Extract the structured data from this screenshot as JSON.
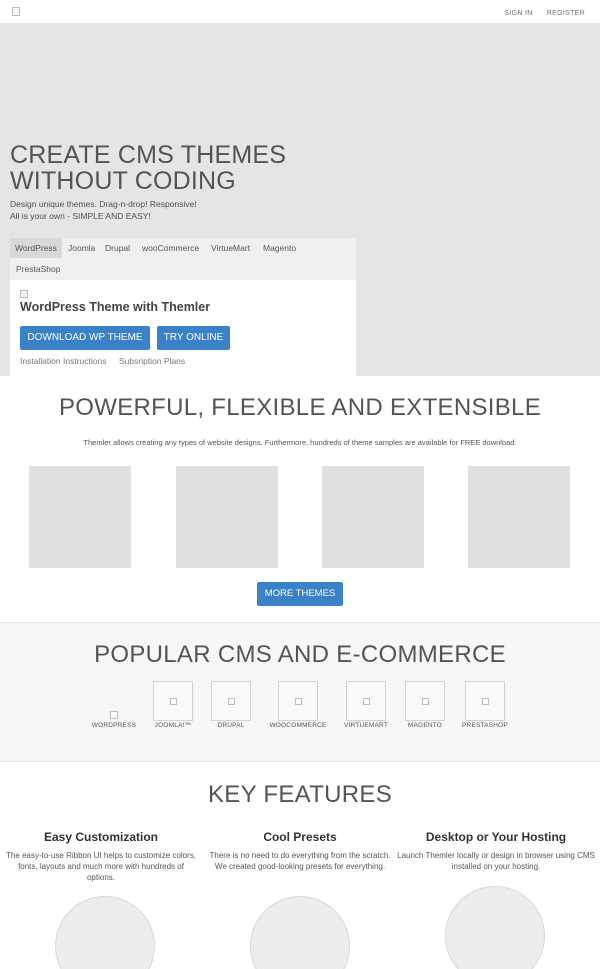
{
  "header": {
    "sign_in": "SIGN IN",
    "register": "REGISTER"
  },
  "hero": {
    "title_line1": "CREATE CMS THEMES",
    "title_line2": "WITHOUT CODING",
    "subtitle_line1": "Design unique themes. Drag-n-drop! Responsive!",
    "subtitle_line2": "All is your own - SIMPLE AND EASY!",
    "tabs": [
      "WordPress",
      "Joomla",
      "Drupal",
      "wooCommerce",
      "VirtueMart",
      "Magento",
      "PrestaShop"
    ],
    "active_tab": "WordPress",
    "panel_title": "WordPress Theme with Themler",
    "download_button": "DOWNLOAD WP THEME",
    "try_button": "TRY ONLINE",
    "install_link": "Installation Instructions",
    "plans_link": "Subsription Plans"
  },
  "themes": {
    "title": "POWERFUL, FLEXIBLE AND EXTENSIBLE",
    "description": "Themler allows creating any types of website designs. Furthermore, hundreds of theme samples are available for FREE download.",
    "more_button": "MORE THEMES"
  },
  "cms": {
    "title": "POPULAR CMS AND E-COMMERCE",
    "items": [
      "WORDPRESS",
      "JOOMLA!™",
      "DRUPAL",
      "WOOCOMMERCE",
      "VIRTUEMART",
      "MAGENTO",
      "PRESTASHOP"
    ]
  },
  "features": {
    "title": "KEY FEATURES",
    "items": [
      {
        "title": "Easy Customization",
        "desc": "The easy-to-use Ribbon UI helps to customize colors, fonts, layouts and much more with hundreds of options."
      },
      {
        "title": "Cool Presets",
        "desc": "There is no need to do everything from the scratch. We created good-looking presets for everything."
      },
      {
        "title": "Desktop or Your Hosting",
        "desc": "Launch Themler locally or design in browser using CMS installed on your hosting."
      }
    ]
  },
  "colors": {
    "accent": "#3a81ca",
    "hero_bg": "#e5e5e5"
  }
}
